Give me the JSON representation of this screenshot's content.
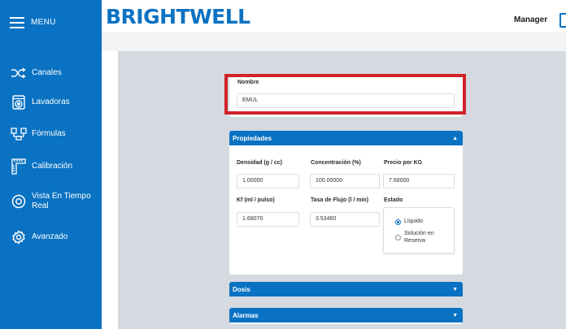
{
  "sidebar": {
    "menu_label": "MENU",
    "items": [
      {
        "label": "Canales",
        "icon": "shuffle-icon"
      },
      {
        "label": "Lavadoras",
        "icon": "washing-machine-icon"
      },
      {
        "label": "Fórmulas",
        "icon": "formula-icon"
      },
      {
        "label": "Calibración",
        "icon": "ruler-icon"
      },
      {
        "label": "Vista En Tiempo Real",
        "icon": "eye-icon"
      },
      {
        "label": "Avanzado",
        "icon": "gear-icon"
      }
    ]
  },
  "header": {
    "logo": "BRIGHTWELL",
    "user_label": "Manager"
  },
  "form": {
    "name_label": "Nombre",
    "name_value": "EMUL"
  },
  "properties": {
    "title": "Propiedades",
    "density_label": "Densidad (g / cc)",
    "density_value": "1.00000",
    "concentration_label": "Concentración (%)",
    "concentration_value": "100.00000",
    "price_label": "Precio por KG",
    "price_value": "7.68000",
    "kf_label": "Kf (ml / pulso)",
    "kf_value": "1.68070",
    "flow_label": "Tasa de Flujo (l / min)",
    "flow_value": "3.53460",
    "state_label": "Estado",
    "state_options": [
      "Líquido",
      "Solución en Reserva"
    ],
    "state_selected": "Líquido"
  },
  "dosis": {
    "title": "Dosis"
  },
  "alarmas": {
    "title": "Alarmas"
  },
  "colors": {
    "brand_blue": "#0a72c2",
    "highlight_red": "#d2232a",
    "content_bg": "#d5d9e0"
  }
}
